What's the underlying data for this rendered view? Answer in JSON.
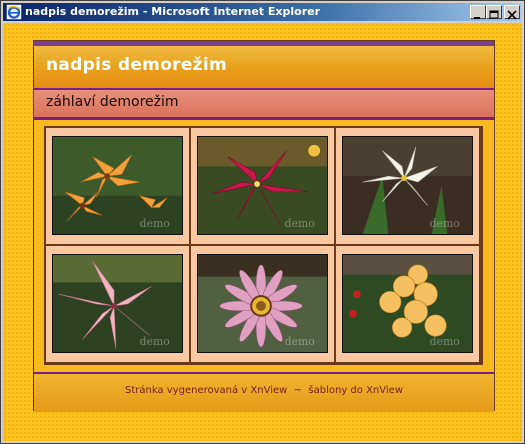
{
  "window": {
    "title": "nadpis demorežim - Microsoft Internet Explorer"
  },
  "page": {
    "site_title": "nadpis demorežim",
    "subtitle": "záhlaví demorežim",
    "gallery": [
      {
        "name": "thumb-orange-lilies",
        "watermark": "demo"
      },
      {
        "name": "thumb-red-lily",
        "watermark": "demo"
      },
      {
        "name": "thumb-white-lily",
        "watermark": "demo"
      },
      {
        "name": "thumb-pink-lily",
        "watermark": "demo"
      },
      {
        "name": "thumb-gazania",
        "watermark": "demo"
      },
      {
        "name": "thumb-gladiolus",
        "watermark": "demo"
      }
    ],
    "footer": {
      "prefix": "Stránka vygenerovaná v ",
      "link1": "XnView",
      "separator": "  ~  ",
      "middle": "šablony do ",
      "link2": "XnView"
    }
  },
  "colors": {
    "background": "#fbc21e",
    "title_bar": "#0a246a",
    "accent_purple": "#7a1f8a",
    "cell_bg": "#f9c8a0"
  }
}
